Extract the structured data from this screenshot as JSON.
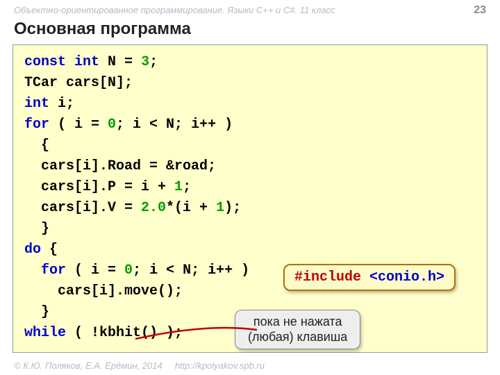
{
  "header": {
    "subject": "Объектно-ориентированное программирование. Языки C++ и C#. 11 класс",
    "page_number": "23"
  },
  "title": "Основная программа",
  "code": {
    "l1": {
      "a": "const",
      "b": "int",
      "c": " N = ",
      "d": "3",
      "e": ";"
    },
    "l2": "TCar cars[N];",
    "l3": {
      "a": "int",
      "b": " i;"
    },
    "l4": {
      "a": "for",
      "b": " ( i = ",
      "c": "0",
      "d": "; i < N; i++ )"
    },
    "l5": "  {",
    "l6": "  cars[i].Road = &road;",
    "l7": {
      "a": "  cars[i].P = i + ",
      "b": "1",
      "c": ";"
    },
    "l8": {
      "a": "  cars[i].V = ",
      "b": "2.0",
      "c": "*(i + ",
      "d": "1",
      "e": ");"
    },
    "l9": "  }",
    "l10": {
      "a": "do",
      "b": " {"
    },
    "l11": {
      "a": "  ",
      "b": "for",
      "c": " ( i = ",
      "d": "0",
      "e": "; i < N; i++ )"
    },
    "l12": "    cars[i].move();",
    "l13": "  }",
    "l14": {
      "a": "while",
      "b": " ( !kbhit() );"
    }
  },
  "callout_include": {
    "directive": "#include",
    "header": " <conio.h>"
  },
  "speech": {
    "line1": "пока не нажата",
    "line2": "(любая) клавиша"
  },
  "footer": {
    "copyright": "© К.Ю. Поляков, Е.А. Ерёмин, 2014",
    "url": "http://kpolyakov.spb.ru"
  }
}
